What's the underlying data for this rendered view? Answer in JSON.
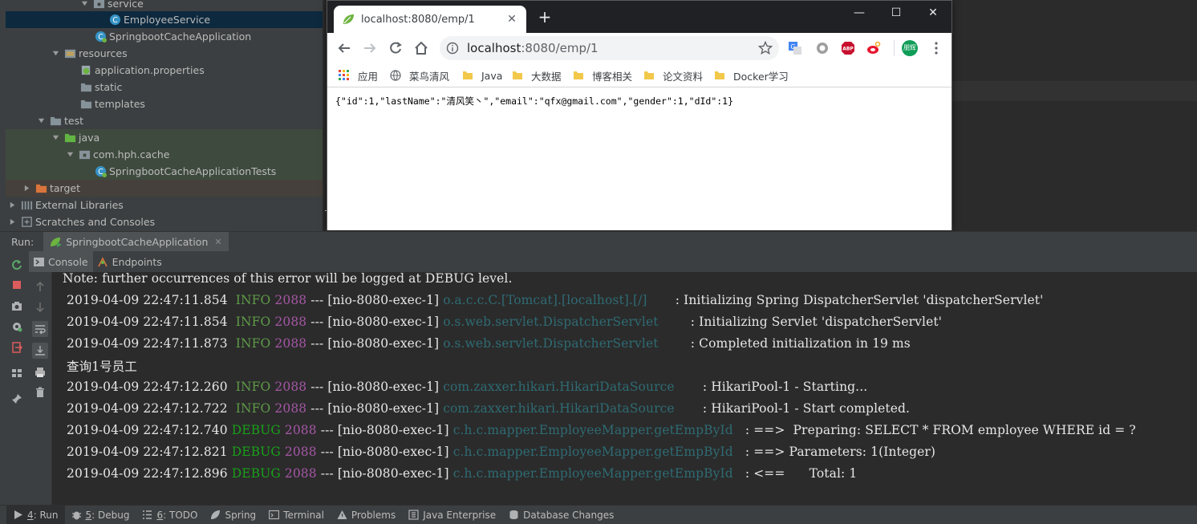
{
  "project_tree": {
    "items": [
      {
        "label": "service",
        "icon": "package-folder-icon"
      },
      {
        "label": "EmployeeService",
        "icon": "class-icon"
      },
      {
        "label": "SpringbootCacheApplication",
        "icon": "spring-class-icon"
      },
      {
        "label": "resources",
        "icon": "resources-folder-icon"
      },
      {
        "label": "application.properties",
        "icon": "properties-file-icon"
      },
      {
        "label": "static",
        "icon": "folder-icon"
      },
      {
        "label": "templates",
        "icon": "folder-icon"
      },
      {
        "label": "test",
        "icon": "folder-icon"
      },
      {
        "label": "java",
        "icon": "test-source-folder-icon"
      },
      {
        "label": "com.hph.cache",
        "icon": "package-folder-icon"
      },
      {
        "label": "SpringbootCacheApplicationTests",
        "icon": "spring-class-icon"
      },
      {
        "label": "target",
        "icon": "excluded-folder-icon"
      },
      {
        "label": "External Libraries",
        "icon": "library-icon"
      },
      {
        "label": "Scratches and Consoles",
        "icon": "scratches-icon"
      }
    ]
  },
  "browser": {
    "tab_title": "localhost:8080/emp/1",
    "tab_close": "✕",
    "new_tab": "+",
    "window_controls": {
      "minimize": "—",
      "maximize": "☐",
      "close": "✕"
    },
    "url_host": "localhost",
    "url_path": ":8080/emp/1",
    "profile_label": "朋辉",
    "bookmarks": [
      "应用",
      "菜鸟清风",
      "Java",
      "大数据",
      "博客相关",
      "论文资料",
      "Docker学习"
    ],
    "page_text": "{\"id\":1,\"lastName\":\"清风笑丶\",\"email\":\"qfx@gmail.com\",\"gender\":1,\"dId\":1}"
  },
  "run_panel": {
    "run_label": "Run:",
    "run_tab": "SpringbootCacheApplication",
    "run_tab_close": "✕",
    "subtabs": [
      "Console",
      "Endpoints"
    ]
  },
  "console": {
    "first_line": " Note: further occurrences of this error will be logged at DEBUG level.",
    "lines": [
      {
        "ts": "2019-04-09 22:47:11.854",
        "level": "INFO",
        "pid": "2088",
        "sep": "---",
        "thread": "[nio-8080-exec-1]",
        "logger": "o.a.c.c.C.[Tomcat].[localhost].[/]",
        "msg": ": Initializing Spring DispatcherServlet 'dispatcherServlet'"
      },
      {
        "ts": "2019-04-09 22:47:11.854",
        "level": "INFO",
        "pid": "2088",
        "sep": "---",
        "thread": "[nio-8080-exec-1]",
        "logger": "o.s.web.servlet.DispatcherServlet",
        "msg": ": Initializing Servlet 'dispatcherServlet'"
      },
      {
        "ts": "2019-04-09 22:47:11.873",
        "level": "INFO",
        "pid": "2088",
        "sep": "---",
        "thread": "[nio-8080-exec-1]",
        "logger": "o.s.web.servlet.DispatcherServlet",
        "msg": ": Completed initialization in 19 ms"
      },
      {
        "plain": "查询1号员工"
      },
      {
        "ts": "2019-04-09 22:47:12.260",
        "level": "INFO",
        "pid": "2088",
        "sep": "---",
        "thread": "[nio-8080-exec-1]",
        "logger": "com.zaxxer.hikari.HikariDataSource",
        "msg": ": HikariPool-1 - Starting..."
      },
      {
        "ts": "2019-04-09 22:47:12.722",
        "level": "INFO",
        "pid": "2088",
        "sep": "---",
        "thread": "[nio-8080-exec-1]",
        "logger": "com.zaxxer.hikari.HikariDataSource",
        "msg": ": HikariPool-1 - Start completed."
      },
      {
        "ts": "2019-04-09 22:47:12.740",
        "level": "DEBUG",
        "pid": "2088",
        "sep": "---",
        "thread": "[nio-8080-exec-1]",
        "logger": "c.h.c.mapper.EmployeeMapper.getEmpById",
        "msg": ": ==>  Preparing: SELECT * FROM employee WHERE id = ?"
      },
      {
        "ts": "2019-04-09 22:47:12.821",
        "level": "DEBUG",
        "pid": "2088",
        "sep": "---",
        "thread": "[nio-8080-exec-1]",
        "logger": "c.h.c.mapper.EmployeeMapper.getEmpById",
        "msg": ": ==> Parameters: 1(Integer)"
      },
      {
        "ts": "2019-04-09 22:47:12.896",
        "level": "DEBUG",
        "pid": "2088",
        "sep": "---",
        "thread": "[nio-8080-exec-1]",
        "logger": "c.h.c.mapper.EmployeeMapper.getEmpById",
        "msg": ": <==      Total: 1"
      }
    ]
  },
  "status_bar": {
    "items": [
      {
        "key": "4",
        "label": ": Run",
        "icon": "run-icon"
      },
      {
        "key": "5",
        "label": ": Debug",
        "icon": "debug-icon"
      },
      {
        "key": "6",
        "label": ": TODO",
        "icon": "todo-icon"
      },
      {
        "key": "",
        "label": "Spring",
        "icon": "spring-icon"
      },
      {
        "key": "",
        "label": "Terminal",
        "icon": "terminal-icon"
      },
      {
        "key": "",
        "label": "Problems",
        "icon": "warning-icon"
      },
      {
        "key": "",
        "label": "Java Enterprise",
        "icon": "java-enterprise-icon"
      },
      {
        "key": "",
        "label": "Database Changes",
        "icon": "database-icon"
      }
    ]
  },
  "colors": {
    "info": "#5e9a48",
    "debug": "#19a019",
    "pid": "#a557a5",
    "logger": "#2e6b73",
    "selection": "#0d293e"
  }
}
